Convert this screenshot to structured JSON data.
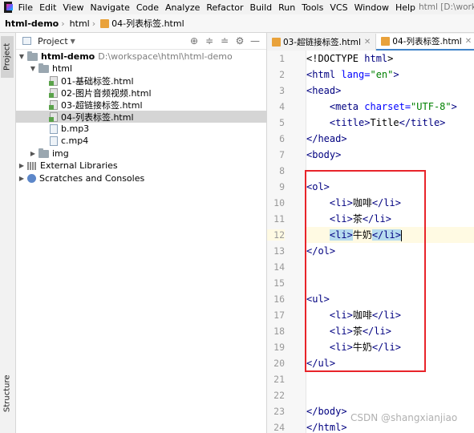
{
  "menu": {
    "items": [
      "File",
      "Edit",
      "View",
      "Navigate",
      "Code",
      "Analyze",
      "Refactor",
      "Build",
      "Run",
      "Tools",
      "VCS",
      "Window",
      "Help"
    ],
    "window_title": "html [D:\\workspace\\ht"
  },
  "breadcrumb": [
    "html-demo",
    "html",
    "04-列表标签.html"
  ],
  "sidestripe": {
    "project_tab": "Project",
    "structure_tab": "Structure"
  },
  "project_panel": {
    "title": "Project",
    "root": {
      "name": "html-demo",
      "path": "D:\\workspace\\html\\html-demo"
    },
    "tree": [
      {
        "label": "html"
      },
      {
        "label": "01-基础标签.html"
      },
      {
        "label": "02-图片音频视频.html"
      },
      {
        "label": "03-超链接标签.html"
      },
      {
        "label": "04-列表标签.html"
      },
      {
        "label": "b.mp3"
      },
      {
        "label": "c.mp4"
      },
      {
        "label": "img"
      },
      {
        "label": "External Libraries"
      },
      {
        "label": "Scratches and Consoles"
      }
    ]
  },
  "editor": {
    "tabs": [
      "03-超链接标签.html",
      "04-列表标签.html"
    ],
    "line_numbers": [
      "1",
      "2",
      "3",
      "4",
      "5",
      "6",
      "7",
      "8",
      "9",
      "10",
      "11",
      "12",
      "13",
      "14",
      "15",
      "16",
      "17",
      "18",
      "19",
      "20",
      "21",
      "22",
      "23",
      "24"
    ],
    "code": {
      "l1_doctype": "<!DOCTYPE ",
      "l1_html": "html",
      "l1_end": ">",
      "l2_open": "<html ",
      "l2_attr": "lang=",
      "l2_val": "\"en\"",
      "l2_end": ">",
      "l3": "<head>",
      "l4_open": "    <meta ",
      "l4_attr": "charset=",
      "l4_val": "\"UTF-8\"",
      "l4_end": ">",
      "l5_open": "    <title>",
      "l5_text": "Title",
      "l5_close": "</title>",
      "l6": "</head>",
      "l7": "<body>",
      "l9": "<ol>",
      "l10_text": "咖啡",
      "l11_text": "茶",
      "l12_text": "牛奶",
      "l13": "</ol>",
      "l16": "<ul>",
      "l17_text": "咖啡",
      "l18_text": "茶",
      "l19_text": "牛奶",
      "l20": "</ul>",
      "l23": "</body>",
      "l24": "</html>",
      "li_open": "<li>",
      "li_close": "</li>",
      "indent": "    "
    }
  },
  "watermark": "CSDN @shangxianjiao",
  "colors": {
    "highlight_box": "#e8242a",
    "tag": "#000080",
    "attribute": "#0000ff",
    "string": "#008000"
  }
}
